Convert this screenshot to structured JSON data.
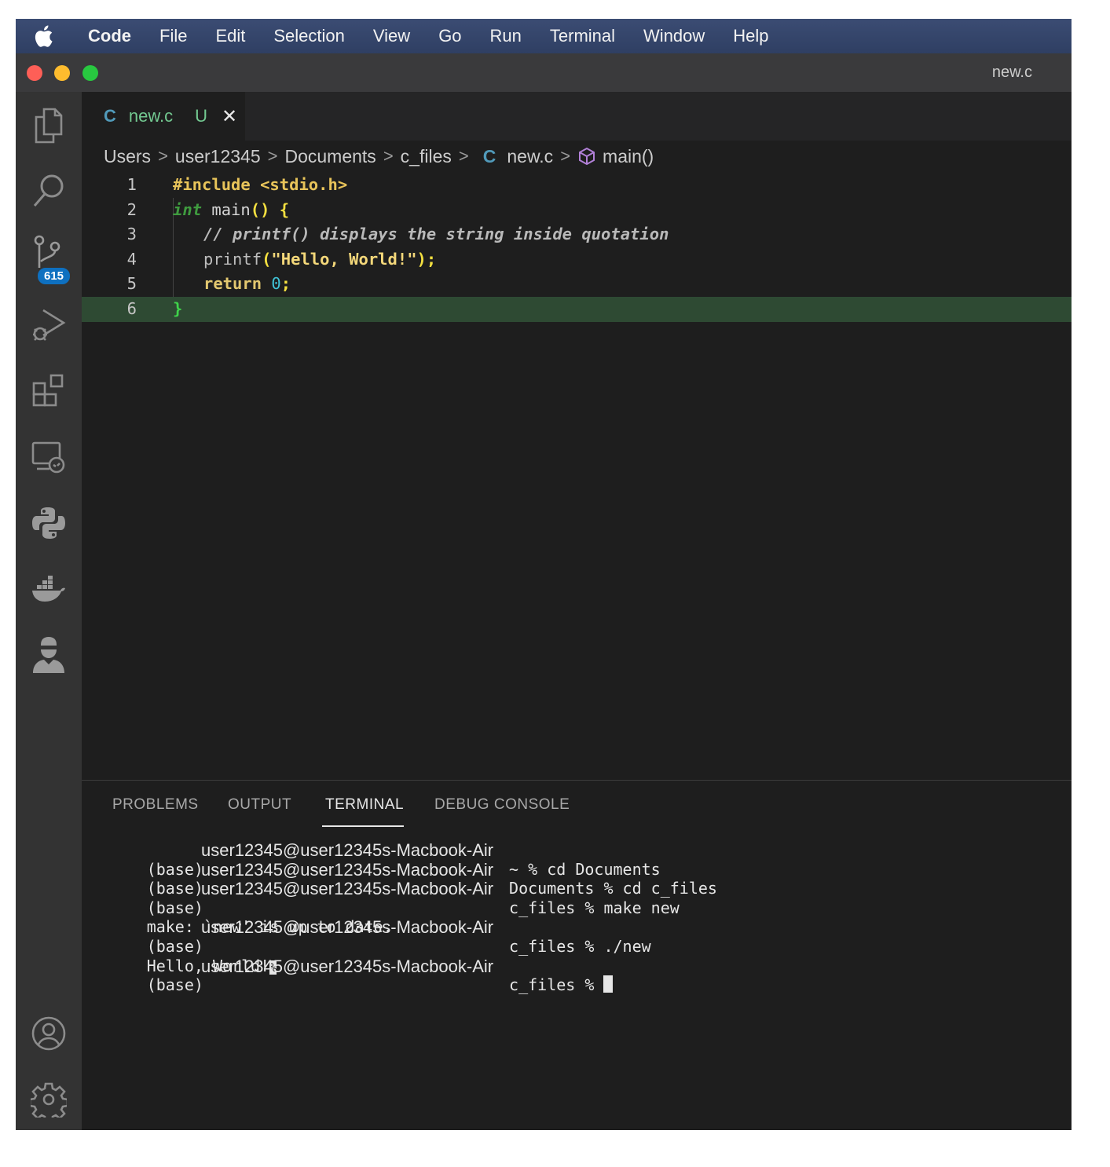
{
  "menubar": {
    "items": [
      "Code",
      "File",
      "Edit",
      "Selection",
      "View",
      "Go",
      "Run",
      "Terminal",
      "Window",
      "Help"
    ]
  },
  "window": {
    "title": "new.c"
  },
  "activitybar": {
    "items": [
      "explorer-icon",
      "search-icon",
      "source-control-icon",
      "run-debug-icon",
      "extensions-icon",
      "remote-explorer-icon",
      "python-icon",
      "docker-icon",
      "live-share-icon"
    ],
    "source_control_badge": "615",
    "bottom": [
      "account-icon",
      "settings-gear-icon"
    ]
  },
  "tab": {
    "icon": "C",
    "name": "new.c",
    "status": "U",
    "close": "✕"
  },
  "breadcrumb": [
    "Users",
    "user12345",
    "Documents",
    "c_files",
    "new.c",
    "main()"
  ],
  "breadcrumb_file_icon": "C",
  "editor": {
    "line_numbers": [
      "1",
      "2",
      "3",
      "4",
      "5",
      "6"
    ],
    "current_line": 6,
    "code": {
      "l1_pre": "#include <stdio.h>",
      "l2_type": "int",
      "l2_fn": " main",
      "l2_punc": "() {",
      "l3_comment": "// printf() displays the string inside quotation",
      "l4_fn": "printf",
      "l4_open": "(",
      "l4_str": "\"Hello, World!\"",
      "l4_close": ");",
      "l5_kw": "return ",
      "l5_num": "0",
      "l5_semi": ";",
      "l6_brace": "}"
    }
  },
  "panel": {
    "tabs": [
      "PROBLEMS",
      "OUTPUT",
      "TERMINAL",
      "DEBUG CONSOLE"
    ],
    "active_tab": "TERMINAL",
    "terminal": {
      "env": "(base)",
      "host": "user12345@user12345s-Macbook-Air",
      "lines": [
        {
          "cmd": " ~ % cd Documents"
        },
        {
          "cmd": " Documents % cd c_files"
        },
        {
          "cmd": " c_files % make new"
        },
        {
          "plain": "make: `new' is up to date."
        },
        {
          "cmd": " c_files % ./new"
        },
        {
          "plain": "Hello, World!",
          "mark": "%"
        },
        {
          "cmd": " c_files % "
        }
      ]
    }
  },
  "colors": {
    "menubar": "#334366",
    "activitybar": "#333333",
    "editor_bg": "#1e1e1e",
    "badge": "#0e70c0",
    "current_line": "#2e4a33"
  }
}
